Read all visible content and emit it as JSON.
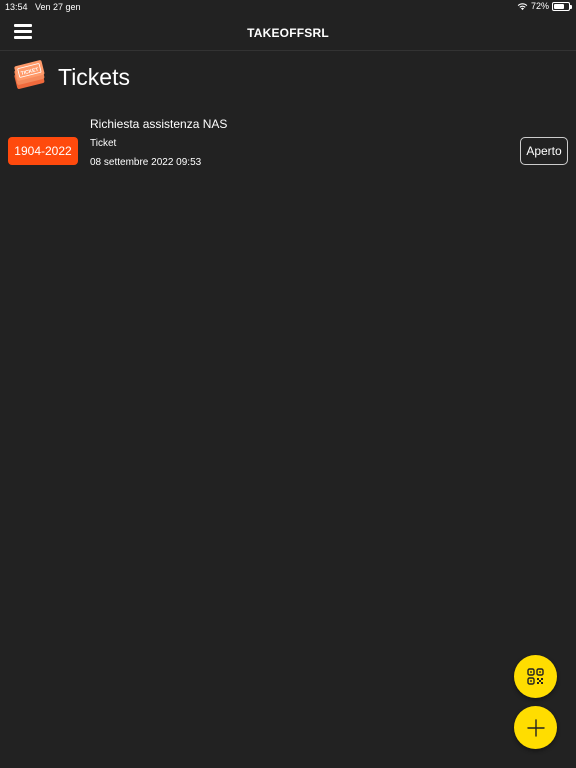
{
  "status_bar": {
    "time": "13:54",
    "date": "Ven 27 gen",
    "battery": "72%",
    "battery_level": 0.72
  },
  "nav": {
    "title": "TAKEOFFSRL",
    "menu_icon": "hamburger-menu-icon"
  },
  "page": {
    "title": "Tickets",
    "logo_icon": "tickets-icon"
  },
  "tickets": [
    {
      "id": "1904-2022",
      "subject": "Richiesta assistenza NAS",
      "type": "Ticket",
      "date": "08 settembre 2022 09:53",
      "status": "Aperto"
    }
  ],
  "fabs": {
    "qr_icon": "qr-code-icon",
    "add_icon": "plus-icon"
  },
  "colors": {
    "background": "#222222",
    "accent_orange": "#ff4a0d",
    "fab_yellow": "#ffdd00"
  }
}
